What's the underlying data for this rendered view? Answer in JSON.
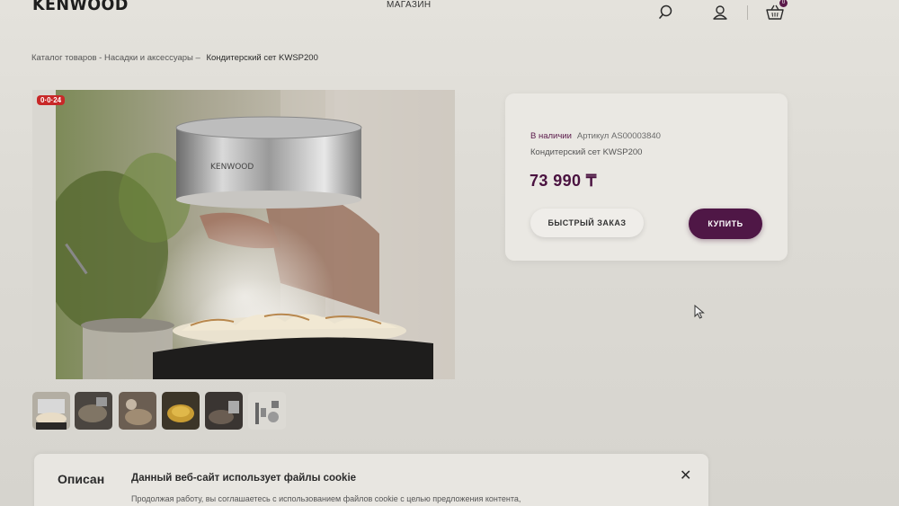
{
  "header": {
    "logo": "KENWOOD",
    "nav_shop": "МАГАЗИН",
    "icons": [
      "search-icon",
      "user-icon",
      "cart-icon"
    ],
    "cart_count": "0"
  },
  "breadcrumb": {
    "path": "Каталог товаров - Насадки и аксессуары –",
    "current": "Кондитерский сет KWSP200"
  },
  "gallery": {
    "badge": "0·0·24",
    "prev_icon": "arrow-left-icon",
    "next_icon": "arrow-right-icon",
    "thumbnail_count": 6
  },
  "product": {
    "availability": "В наличии",
    "sku": "Артикул AS00003840",
    "name": "Кондитерский сет KWSP200",
    "price": "73 990 ₸",
    "quick_order_label": "БЫСТРЫЙ ЗАКАЗ",
    "buy_label": "КУПИТЬ"
  },
  "cookie_banner": {
    "description_tab": "Описан",
    "title": "Данный веб-сайт использует файлы cookie",
    "text": "Продолжая работу, вы соглашаетесь с использованием файлов cookie с целью предложения контента,",
    "close_icon": "close-icon"
  },
  "colors": {
    "brand": "#4f1746",
    "badge_red": "#c82828",
    "background": "#e0ded8"
  }
}
